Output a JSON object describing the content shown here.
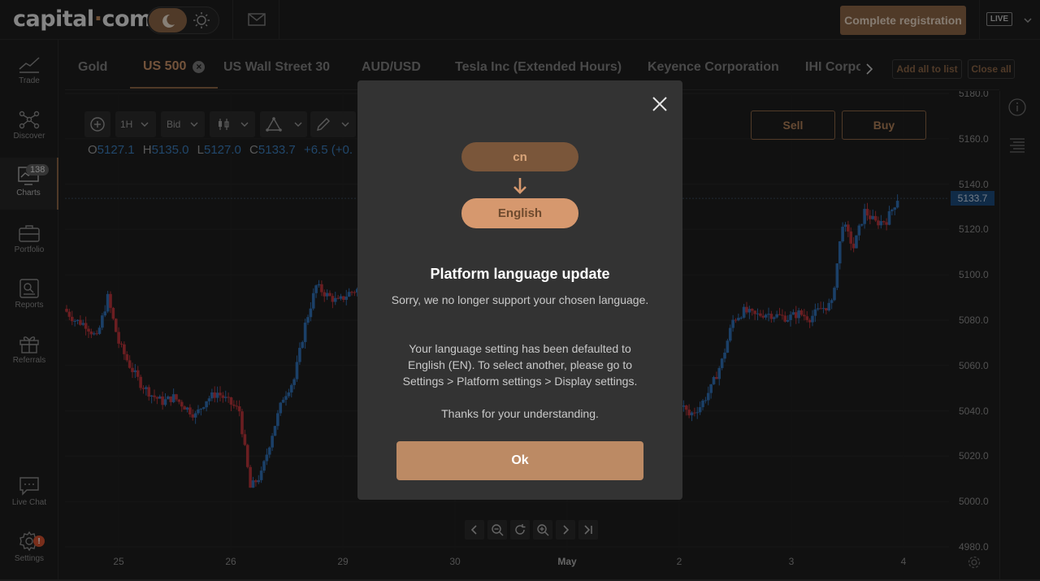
{
  "brand": {
    "logo_left": "capital",
    "logo_dot": "·",
    "logo_right": "com"
  },
  "header": {
    "register_label": "Complete registration",
    "account_mode": "LIVE"
  },
  "sidebar": {
    "items": [
      {
        "label": "Trade",
        "icon": "trade-icon"
      },
      {
        "label": "Discover",
        "icon": "discover-icon"
      },
      {
        "label": "Charts",
        "icon": "charts-icon",
        "count": "138"
      },
      {
        "label": "Portfolio",
        "icon": "portfolio-icon"
      },
      {
        "label": "Reports",
        "icon": "reports-icon"
      },
      {
        "label": "Referrals",
        "icon": "gift-icon"
      },
      {
        "label": "Live Chat",
        "icon": "chat-icon"
      },
      {
        "label": "Settings",
        "icon": "gear-icon",
        "alert": "!"
      }
    ]
  },
  "tabs": {
    "items": [
      "Gold",
      "US 500",
      "US Wall Street 30",
      "AUD/USD",
      "Tesla Inc (Extended Hours)",
      "Keyence Corporation",
      "IHI Corpo"
    ],
    "active": "US 500",
    "add_all_label": "Add all to list",
    "close_all_label": "Close all"
  },
  "toolbar": {
    "timeframe": "1H",
    "price_type": "Bid",
    "sell_label": "Sell",
    "buy_label": "Buy"
  },
  "ohlc": {
    "o_key": "O",
    "o": "5127.1",
    "h_key": "H",
    "h": "5135.0",
    "l_key": "L",
    "l": "5127.0",
    "c_key": "C",
    "c": "5133.7",
    "change": "+6.5 (+0."
  },
  "chart_data": {
    "type": "candlestick",
    "instrument": "US 500",
    "timeframe": "1H",
    "current_price": "5133.7",
    "y_ticks": [
      "5180.0",
      "5160.0",
      "5140.0",
      "5120.0",
      "5100.0",
      "5080.0",
      "5060.0",
      "5040.0",
      "5020.0",
      "5000.0",
      "4980.0"
    ],
    "ylim": [
      4980,
      5180
    ],
    "x_ticks": [
      "25",
      "26",
      "29",
      "30",
      "May",
      "2",
      "3",
      "4"
    ],
    "close_series": [
      5085,
      5080,
      5078,
      5072,
      5090,
      5070,
      5060,
      5052,
      5047,
      5044,
      5046,
      5042,
      5038,
      5045,
      5048,
      5044,
      5040,
      5006,
      5012,
      5030,
      5046,
      5054,
      5078,
      5095,
      5091,
      5088,
      5092,
      5094,
      5088,
      5082,
      5086,
      5093,
      5099,
      5110,
      5105,
      5102,
      5098,
      5096,
      5104,
      5106,
      5096,
      5078,
      5072,
      5064,
      5060,
      5057,
      5050,
      5043,
      5035,
      5037,
      5040,
      5042,
      5041,
      5039,
      5046,
      5049,
      5045,
      5038,
      5042,
      5050,
      5062,
      5080,
      5084,
      5082,
      5083,
      5082,
      5081,
      5083,
      5081,
      5085,
      5087,
      5123,
      5112,
      5128,
      5123,
      5124,
      5133.7
    ],
    "up_color": "#2f6fb3",
    "down_color": "#b8343a"
  },
  "chart_nav": {
    "icons": [
      "chevron-left-icon",
      "zoom-out-icon",
      "reset-icon",
      "zoom-in-icon",
      "chevron-right-icon",
      "jump-to-end-icon"
    ]
  },
  "modal": {
    "from_lang": "cn",
    "to_lang": "English",
    "title": "Platform language update",
    "p1": "Sorry, we no longer support your chosen language.",
    "p2": "Your language setting has been defaulted to English (EN). To select another, please go to Settings > Platform settings > Display settings.",
    "p3": "Thanks for your understanding.",
    "ok_label": "Ok"
  },
  "colors": {
    "accent": "#8a6446",
    "accent_light": "#bc8a64",
    "bg": "#1e1e1e",
    "modal_bg": "#333333"
  }
}
